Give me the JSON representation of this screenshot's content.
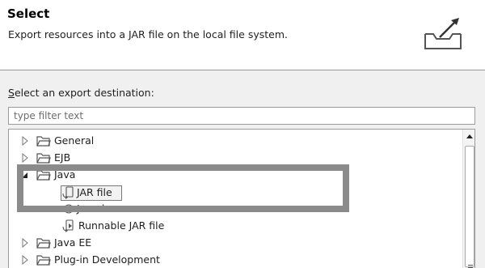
{
  "header": {
    "title": "Select",
    "description": "Export resources into a JAR file on the local file system.",
    "icon": "export-jar-icon"
  },
  "destination": {
    "label_mnemonic": "S",
    "label_rest": "elect an export destination:",
    "filter_placeholder": "type filter text"
  },
  "tree": {
    "items": [
      {
        "label": "General",
        "icon": "folder-icon",
        "expanded": false
      },
      {
        "label": "EJB",
        "icon": "folder-icon",
        "expanded": false
      },
      {
        "label": "Java",
        "icon": "folder-icon",
        "expanded": true
      },
      {
        "label": "JAR file",
        "icon": "jar-icon",
        "selected": true
      },
      {
        "label": "Javadoc",
        "icon": "javadoc-icon"
      },
      {
        "label": "Runnable JAR file",
        "icon": "runnable-jar-icon"
      },
      {
        "label": "Java EE",
        "icon": "folder-icon",
        "expanded": false
      },
      {
        "label": "Plug-in Development",
        "icon": "folder-icon",
        "expanded": false
      }
    ]
  },
  "colors": {
    "highlight_border": "#8b8b8b",
    "dialog_background": "#f0f0f0"
  }
}
